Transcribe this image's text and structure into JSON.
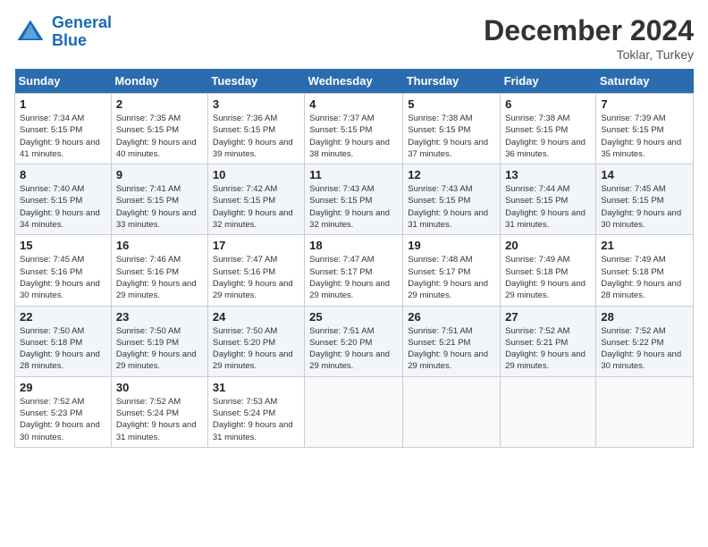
{
  "header": {
    "logo_line1": "General",
    "logo_line2": "Blue",
    "month": "December 2024",
    "location": "Toklar, Turkey"
  },
  "columns": [
    "Sunday",
    "Monday",
    "Tuesday",
    "Wednesday",
    "Thursday",
    "Friday",
    "Saturday"
  ],
  "weeks": [
    [
      {
        "day": "1",
        "rise": "Sunrise: 7:34 AM",
        "set": "Sunset: 5:15 PM",
        "daylight": "Daylight: 9 hours and 41 minutes."
      },
      {
        "day": "2",
        "rise": "Sunrise: 7:35 AM",
        "set": "Sunset: 5:15 PM",
        "daylight": "Daylight: 9 hours and 40 minutes."
      },
      {
        "day": "3",
        "rise": "Sunrise: 7:36 AM",
        "set": "Sunset: 5:15 PM",
        "daylight": "Daylight: 9 hours and 39 minutes."
      },
      {
        "day": "4",
        "rise": "Sunrise: 7:37 AM",
        "set": "Sunset: 5:15 PM",
        "daylight": "Daylight: 9 hours and 38 minutes."
      },
      {
        "day": "5",
        "rise": "Sunrise: 7:38 AM",
        "set": "Sunset: 5:15 PM",
        "daylight": "Daylight: 9 hours and 37 minutes."
      },
      {
        "day": "6",
        "rise": "Sunrise: 7:38 AM",
        "set": "Sunset: 5:15 PM",
        "daylight": "Daylight: 9 hours and 36 minutes."
      },
      {
        "day": "7",
        "rise": "Sunrise: 7:39 AM",
        "set": "Sunset: 5:15 PM",
        "daylight": "Daylight: 9 hours and 35 minutes."
      }
    ],
    [
      {
        "day": "8",
        "rise": "Sunrise: 7:40 AM",
        "set": "Sunset: 5:15 PM",
        "daylight": "Daylight: 9 hours and 34 minutes."
      },
      {
        "day": "9",
        "rise": "Sunrise: 7:41 AM",
        "set": "Sunset: 5:15 PM",
        "daylight": "Daylight: 9 hours and 33 minutes."
      },
      {
        "day": "10",
        "rise": "Sunrise: 7:42 AM",
        "set": "Sunset: 5:15 PM",
        "daylight": "Daylight: 9 hours and 32 minutes."
      },
      {
        "day": "11",
        "rise": "Sunrise: 7:43 AM",
        "set": "Sunset: 5:15 PM",
        "daylight": "Daylight: 9 hours and 32 minutes."
      },
      {
        "day": "12",
        "rise": "Sunrise: 7:43 AM",
        "set": "Sunset: 5:15 PM",
        "daylight": "Daylight: 9 hours and 31 minutes."
      },
      {
        "day": "13",
        "rise": "Sunrise: 7:44 AM",
        "set": "Sunset: 5:15 PM",
        "daylight": "Daylight: 9 hours and 31 minutes."
      },
      {
        "day": "14",
        "rise": "Sunrise: 7:45 AM",
        "set": "Sunset: 5:15 PM",
        "daylight": "Daylight: 9 hours and 30 minutes."
      }
    ],
    [
      {
        "day": "15",
        "rise": "Sunrise: 7:45 AM",
        "set": "Sunset: 5:16 PM",
        "daylight": "Daylight: 9 hours and 30 minutes."
      },
      {
        "day": "16",
        "rise": "Sunrise: 7:46 AM",
        "set": "Sunset: 5:16 PM",
        "daylight": "Daylight: 9 hours and 29 minutes."
      },
      {
        "day": "17",
        "rise": "Sunrise: 7:47 AM",
        "set": "Sunset: 5:16 PM",
        "daylight": "Daylight: 9 hours and 29 minutes."
      },
      {
        "day": "18",
        "rise": "Sunrise: 7:47 AM",
        "set": "Sunset: 5:17 PM",
        "daylight": "Daylight: 9 hours and 29 minutes."
      },
      {
        "day": "19",
        "rise": "Sunrise: 7:48 AM",
        "set": "Sunset: 5:17 PM",
        "daylight": "Daylight: 9 hours and 29 minutes."
      },
      {
        "day": "20",
        "rise": "Sunrise: 7:49 AM",
        "set": "Sunset: 5:18 PM",
        "daylight": "Daylight: 9 hours and 29 minutes."
      },
      {
        "day": "21",
        "rise": "Sunrise: 7:49 AM",
        "set": "Sunset: 5:18 PM",
        "daylight": "Daylight: 9 hours and 28 minutes."
      }
    ],
    [
      {
        "day": "22",
        "rise": "Sunrise: 7:50 AM",
        "set": "Sunset: 5:18 PM",
        "daylight": "Daylight: 9 hours and 28 minutes."
      },
      {
        "day": "23",
        "rise": "Sunrise: 7:50 AM",
        "set": "Sunset: 5:19 PM",
        "daylight": "Daylight: 9 hours and 29 minutes."
      },
      {
        "day": "24",
        "rise": "Sunrise: 7:50 AM",
        "set": "Sunset: 5:20 PM",
        "daylight": "Daylight: 9 hours and 29 minutes."
      },
      {
        "day": "25",
        "rise": "Sunrise: 7:51 AM",
        "set": "Sunset: 5:20 PM",
        "daylight": "Daylight: 9 hours and 29 minutes."
      },
      {
        "day": "26",
        "rise": "Sunrise: 7:51 AM",
        "set": "Sunset: 5:21 PM",
        "daylight": "Daylight: 9 hours and 29 minutes."
      },
      {
        "day": "27",
        "rise": "Sunrise: 7:52 AM",
        "set": "Sunset: 5:21 PM",
        "daylight": "Daylight: 9 hours and 29 minutes."
      },
      {
        "day": "28",
        "rise": "Sunrise: 7:52 AM",
        "set": "Sunset: 5:22 PM",
        "daylight": "Daylight: 9 hours and 30 minutes."
      }
    ],
    [
      {
        "day": "29",
        "rise": "Sunrise: 7:52 AM",
        "set": "Sunset: 5:23 PM",
        "daylight": "Daylight: 9 hours and 30 minutes."
      },
      {
        "day": "30",
        "rise": "Sunrise: 7:52 AM",
        "set": "Sunset: 5:24 PM",
        "daylight": "Daylight: 9 hours and 31 minutes."
      },
      {
        "day": "31",
        "rise": "Sunrise: 7:53 AM",
        "set": "Sunset: 5:24 PM",
        "daylight": "Daylight: 9 hours and 31 minutes."
      },
      null,
      null,
      null,
      null
    ]
  ]
}
